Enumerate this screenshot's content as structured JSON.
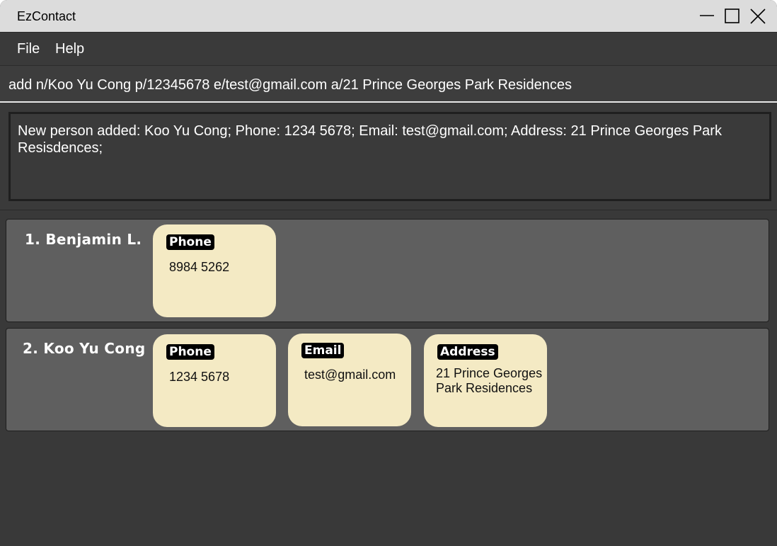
{
  "window": {
    "title": "EzContact",
    "controls": {
      "minimize_icon": "minimize-icon",
      "maximize_icon": "maximize-icon",
      "close_icon": "close-icon"
    }
  },
  "menu": {
    "items": [
      "File",
      "Help"
    ]
  },
  "command_input": {
    "value": "add n/Koo Yu Cong p/12345678 e/test@gmail.com a/21 Prince Georges Park Residences"
  },
  "result": {
    "text": "New person added: Koo Yu Cong; Phone: 1234 5678; Email: test@gmail.com; Address: 21 Prince Georges Park Resisdences;"
  },
  "persons": [
    {
      "name": "1. Benjamin L.",
      "fields": [
        {
          "label": "Phone",
          "value": "8984 5262"
        }
      ]
    },
    {
      "name": "2. Koo Yu Cong",
      "fields": [
        {
          "label": "Phone",
          "value": "1234 5678"
        },
        {
          "label": "Email",
          "value": "test@gmail.com"
        },
        {
          "label": "Address",
          "value": "21 Prince Georges Park Residences"
        }
      ]
    }
  ],
  "colors": {
    "window_bg": "#393939",
    "card_bg": "#5f5f5f",
    "info_card_bg": "#f4eac4",
    "label_bg": "#000000",
    "titlebar_bg": "#dcdcdc"
  }
}
